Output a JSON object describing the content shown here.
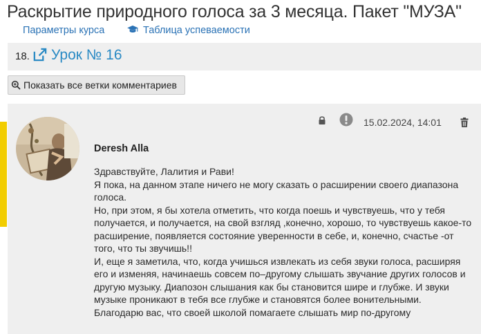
{
  "page": {
    "title": "Раскрытие природного голоса за 3 месяца. Пакет \"МУЗА\""
  },
  "course_links": {
    "params_label": "Параметры курса",
    "grades_label": "Таблица успеваемости",
    "grades_icon": "graduation-cap-icon"
  },
  "lesson": {
    "number": "18.",
    "link_label": "Урок № 16",
    "icon": "external-link-icon"
  },
  "toolbar": {
    "show_threads_label": "Показать все ветки комментариев",
    "show_threads_icon": "zoom-icon"
  },
  "comment": {
    "author": "Deresh Alla",
    "date": "15.02.2024, 14:01",
    "icons": [
      "lock-icon",
      "alert-icon",
      "trash-icon"
    ],
    "paragraphs": [
      "Здравствуйте, Лалития и Рави!",
      "Я пока, на данном этапе ничего не могу сказать о расширении своего диапазона голоса.",
      "Но, при этом, я бы хотела отметить, что когда поешь и чувствуешь, что у тебя получается, и получается, на свой взгляд ,конечно, хорошо, то чувствуешь какое-то расширение, появляется состояние уверенности в себе, и, конечно, счастье -от того, что ты звучишь!!",
      "И, еще я заметила, что, когда учишься извлекать из себя звуки голоса, расширяя его и изменяя, начинаешь совсем по–другому слышать звучание других голосов и другую музыку. Диапозон слышания как бы становится шире и глубже. И звуки музыке проникают в тебя все глубже и становятся более вонительными.",
      "Благодарю вас, что своей школой помагаете слышать мир по-другому"
    ]
  },
  "colors": {
    "link": "#2a72b5",
    "lesson_link": "#2a8ac4",
    "panel_bg": "#efefef",
    "accent": "#f2cd00"
  }
}
